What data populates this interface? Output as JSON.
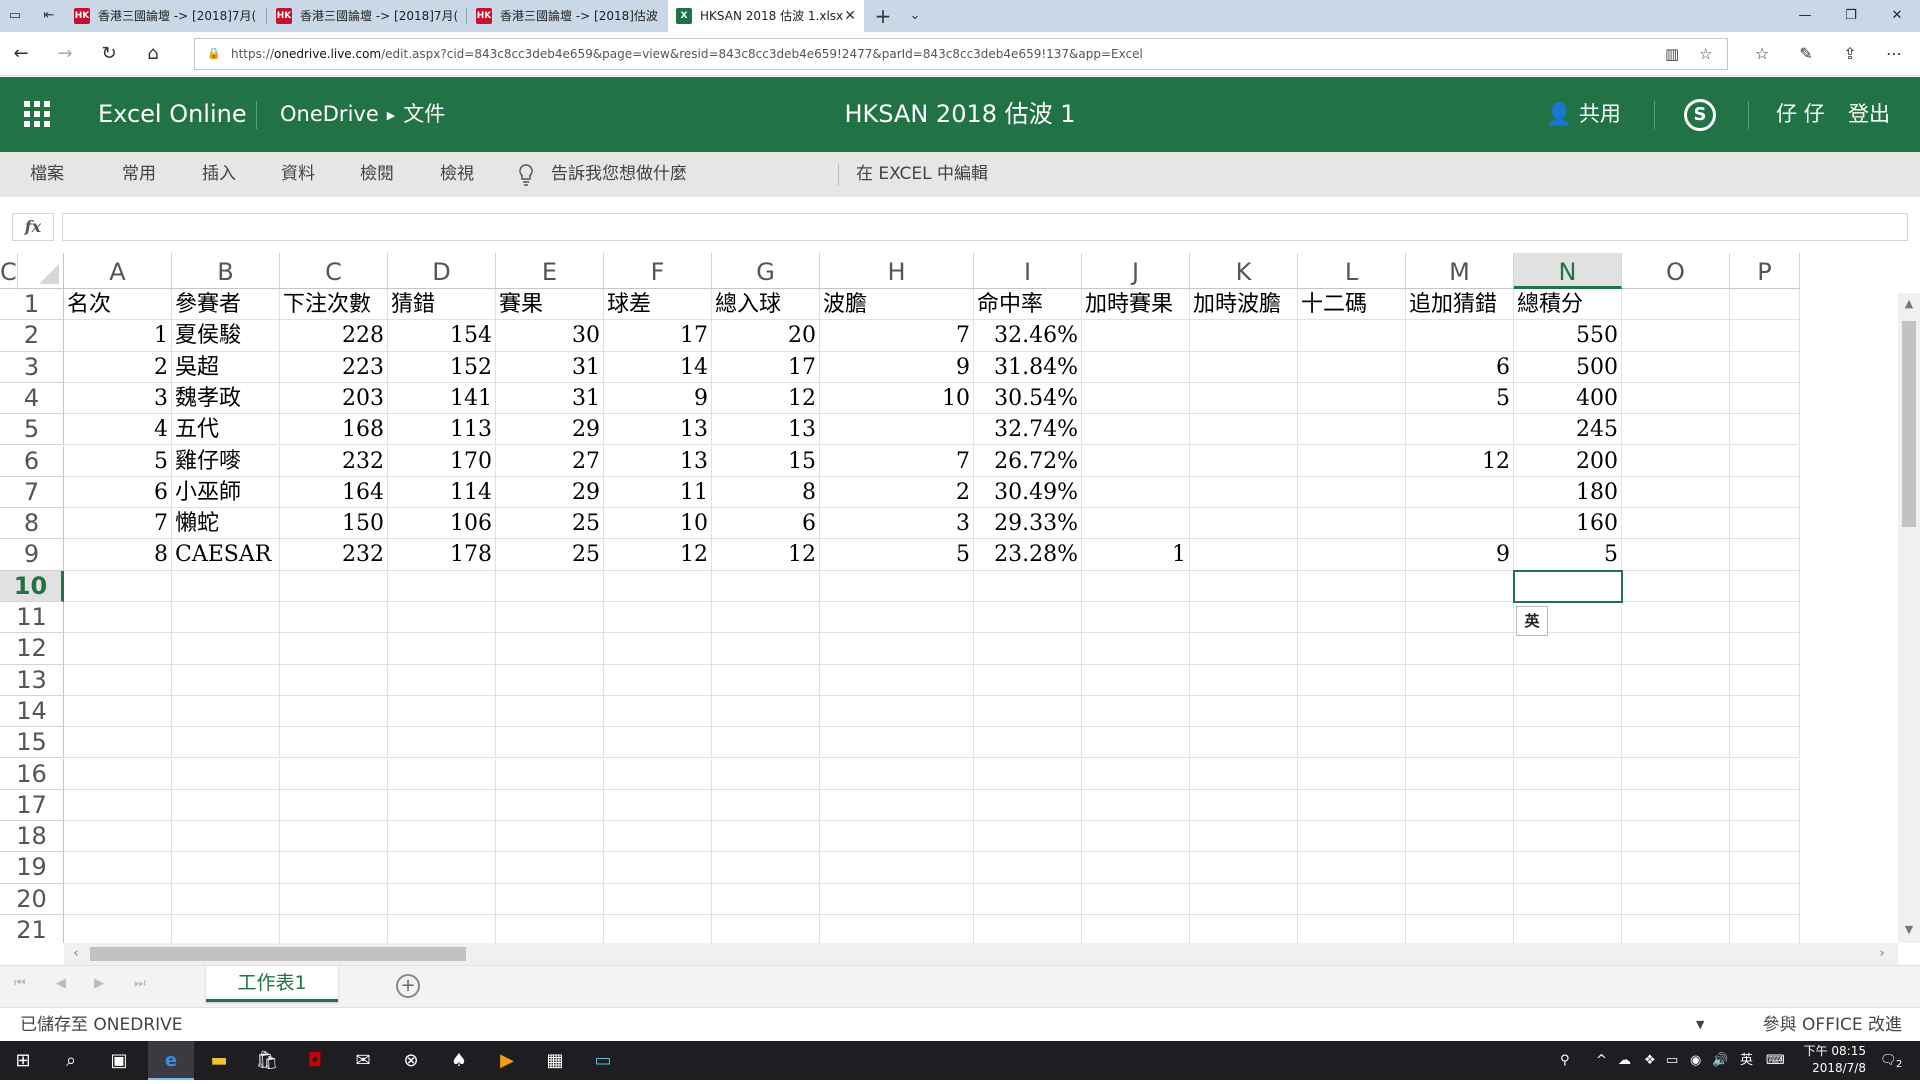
{
  "browser": {
    "tabs": [
      {
        "label": "香港三國論壇 -> [2018]7月(",
        "icon": "HK",
        "active": false
      },
      {
        "label": "香港三國論壇 -> [2018]7月(",
        "icon": "HK",
        "active": false
      },
      {
        "label": "香港三國論壇 -> [2018]估波",
        "icon": "HK",
        "active": false
      },
      {
        "label": "HKSAN 2018 估波 1.xlsx",
        "icon": "X",
        "active": true
      }
    ],
    "url_prefix": "https://",
    "url_host": "onedrive.live.com",
    "url_path": "/edit.aspx?cid=843c8cc3deb4e659&page=view&resid=843c8cc3deb4e659!2477&parId=843c8cc3deb4e659!137&app=Excel"
  },
  "app": {
    "name": "Excel Online",
    "breadcrumb_root": "OneDrive",
    "breadcrumb_folder": "文件",
    "doc_title": "HKSAN 2018 估波 1",
    "share_label": "共用",
    "user_name": "仔 仔",
    "signout_label": "登出"
  },
  "ribbon": {
    "tabs": [
      "檔案",
      "常用",
      "插入",
      "資料",
      "檢閱",
      "檢視"
    ],
    "tell_me": "告訴我您想做什麼",
    "edit_in_excel": "在 EXCEL 中編輯"
  },
  "formula_bar": {
    "fx_label": "fx",
    "value": ""
  },
  "sheet": {
    "columns": [
      "A",
      "B",
      "C",
      "D",
      "E",
      "F",
      "G",
      "H",
      "I",
      "J",
      "K",
      "L",
      "M",
      "N",
      "O",
      "P",
      "C"
    ],
    "selected_column": "N",
    "selected_row": 10,
    "row_numbers": [
      "1",
      "2",
      "3",
      "4",
      "5",
      "6",
      "7",
      "8",
      "9",
      "10",
      "11",
      "12",
      "13",
      "14",
      "15",
      "16",
      "17",
      "18",
      "19",
      "20",
      "21"
    ],
    "header_row": [
      "名次",
      "參賽者",
      "下注次數",
      "猜錯",
      "賽果",
      "球差",
      "總入球",
      "波膽",
      "命中率",
      "加時賽果",
      "加時波膽",
      "十二碼",
      "追加猜錯",
      "總積分"
    ],
    "rows": [
      [
        "1",
        "夏侯駿",
        "228",
        "154",
        "30",
        "17",
        "20",
        "7",
        "32.46%",
        "",
        "",
        "",
        "",
        "550"
      ],
      [
        "2",
        "吳超",
        "223",
        "152",
        "31",
        "14",
        "17",
        "9",
        "31.84%",
        "",
        "",
        "",
        "6",
        "500"
      ],
      [
        "3",
        "魏孝政",
        "203",
        "141",
        "31",
        "9",
        "12",
        "10",
        "30.54%",
        "",
        "",
        "",
        "5",
        "400"
      ],
      [
        "4",
        "五代",
        "168",
        "113",
        "29",
        "13",
        "13",
        "",
        "32.74%",
        "",
        "",
        "",
        "",
        "245"
      ],
      [
        "5",
        "雞仔嘜",
        "232",
        "170",
        "27",
        "13",
        "15",
        "7",
        "26.72%",
        "",
        "",
        "",
        "12",
        "200"
      ],
      [
        "6",
        "小巫師",
        "164",
        "114",
        "29",
        "11",
        "8",
        "2",
        "30.49%",
        "",
        "",
        "",
        "",
        "180"
      ],
      [
        "7",
        "懶蛇",
        "150",
        "106",
        "25",
        "10",
        "6",
        "3",
        "29.33%",
        "",
        "",
        "",
        "",
        "160"
      ],
      [
        "8",
        "CAESAR",
        "232",
        "178",
        "25",
        "12",
        "12",
        "5",
        "23.28%",
        "1",
        "",
        "",
        "9",
        "5"
      ]
    ],
    "ime_indicator": "英"
  },
  "sheet_tabs": {
    "active": "工作表1",
    "add_label": "+"
  },
  "status": {
    "saved": "已儲存至 ONEDRIVE",
    "improve": "參與 OFFICE 改進"
  },
  "taskbar": {
    "ime": "英",
    "time": "下午 08:15",
    "date": "2018/7/8",
    "notifications": "2"
  }
}
